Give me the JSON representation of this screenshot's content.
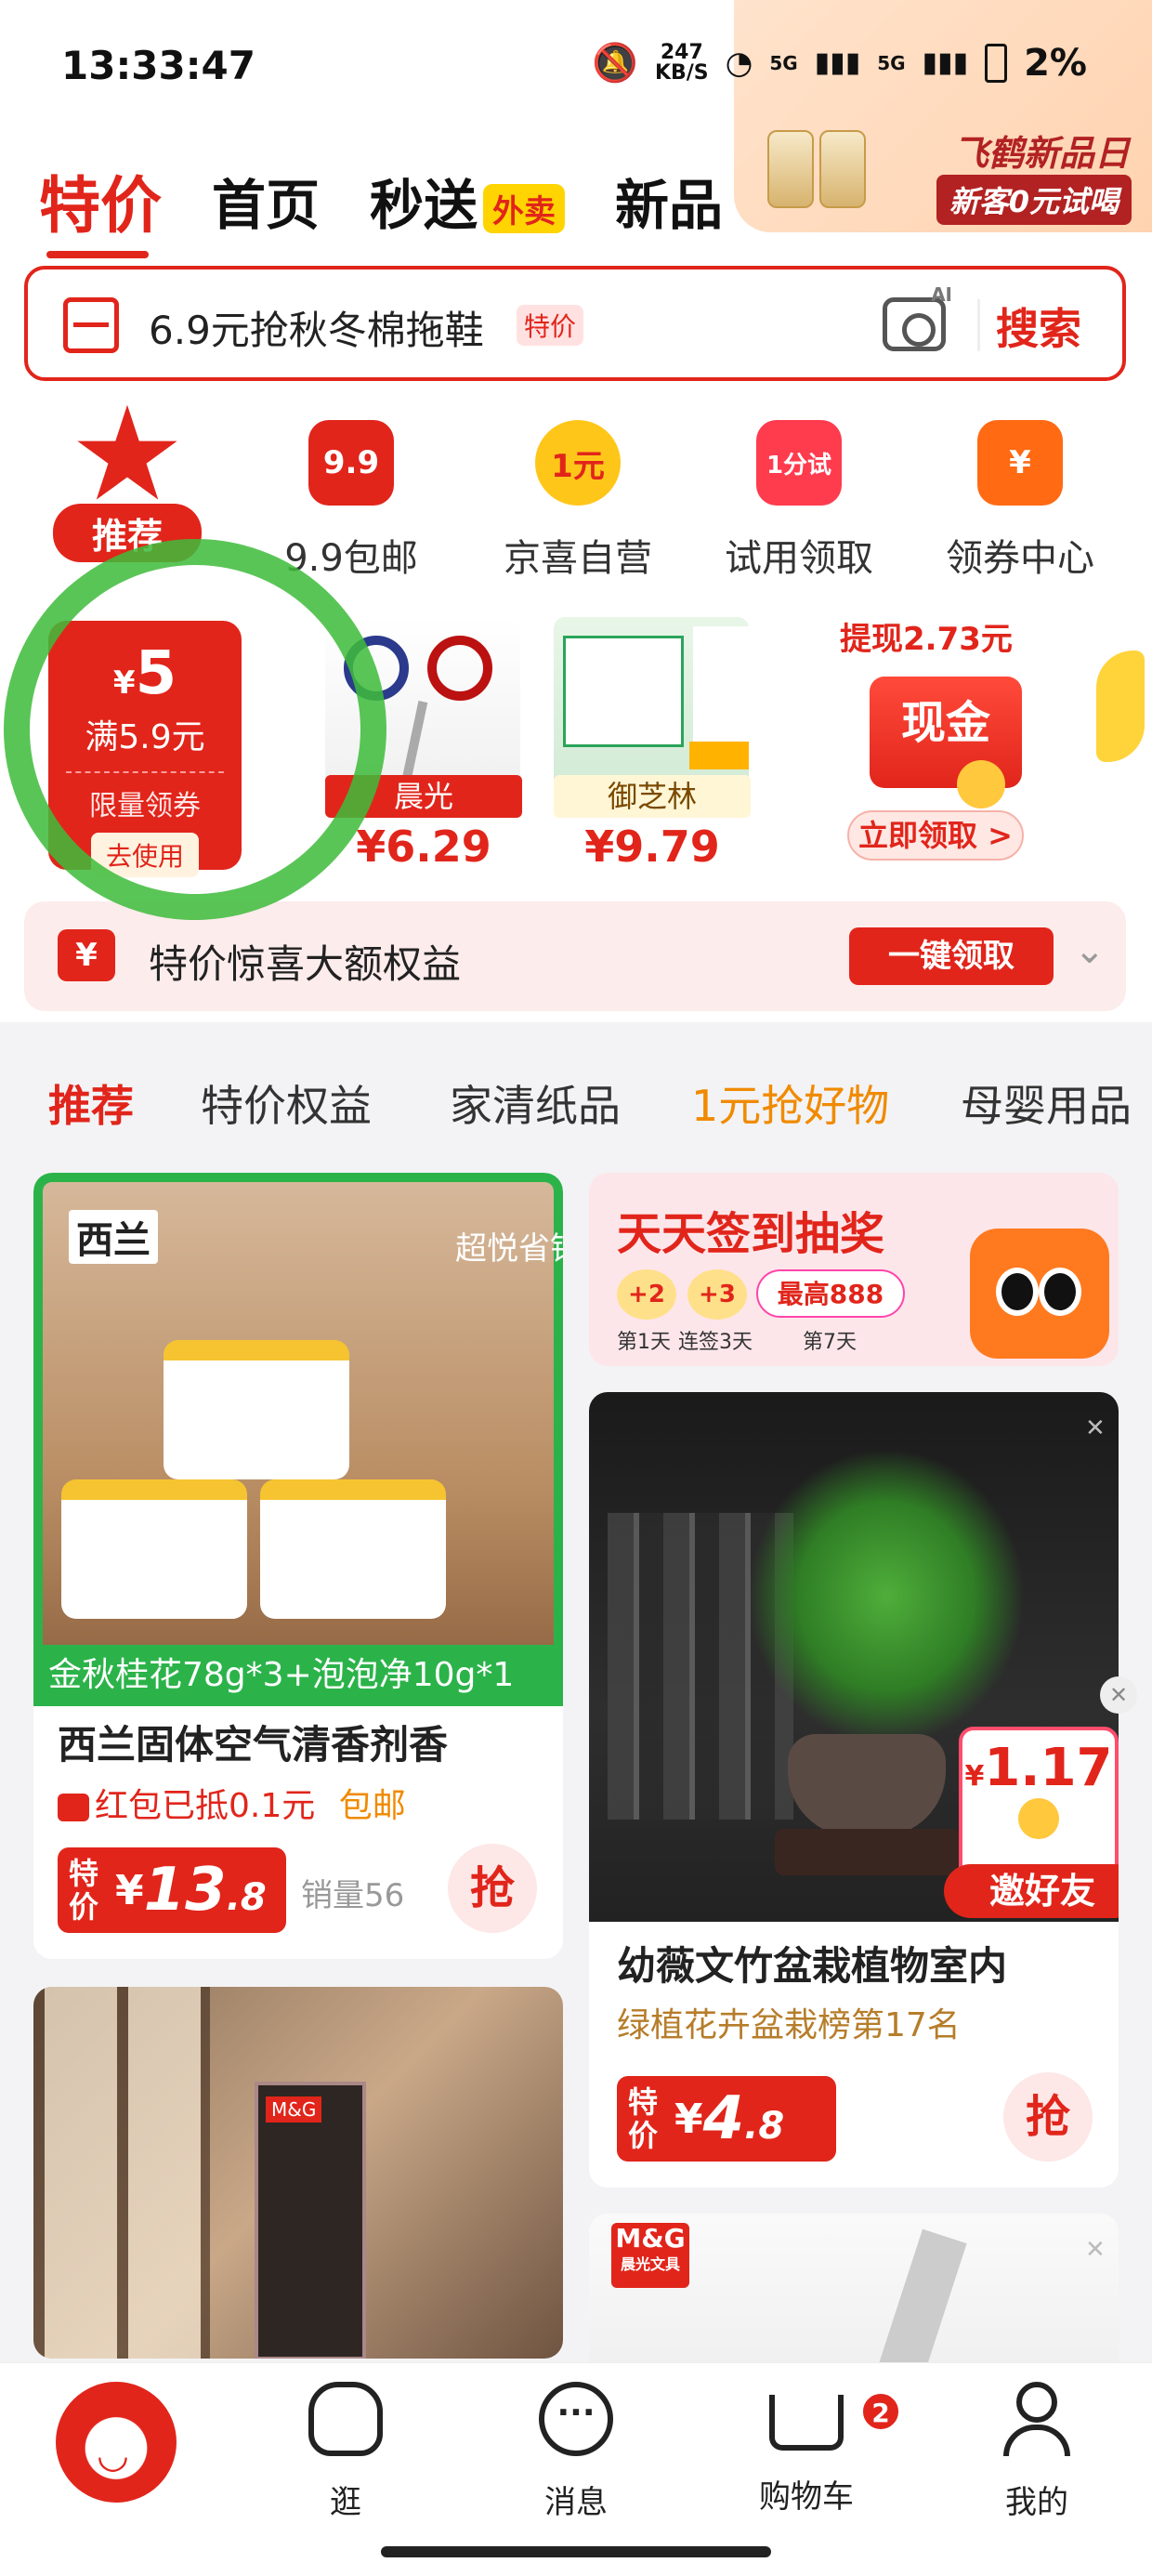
{
  "status": {
    "time": "13:33:47",
    "speed_value": "247",
    "speed_unit": "KB/S",
    "signal1": "5G",
    "signal2": "5G",
    "battery": "2%"
  },
  "promo": {
    "title": "飞鹤新品日",
    "subtitle": "新客0元试喝"
  },
  "top_tabs": [
    {
      "label": "特价"
    },
    {
      "label": "首页"
    },
    {
      "label": "秒送"
    },
    {
      "label": "新品"
    }
  ],
  "takeout_badge": "外卖",
  "search": {
    "query": "6.9元抢秋冬棉拖鞋",
    "badge": "特价",
    "button": "搜索"
  },
  "categories": [
    {
      "label": "推荐",
      "icon": "star-check-icon"
    },
    {
      "label": "9.9包邮",
      "icon_text": "9.9"
    },
    {
      "label": "京喜自营",
      "icon_text": "1元"
    },
    {
      "label": "试用领取",
      "icon_text": "1分试"
    },
    {
      "label": "领券中心",
      "icon_text": "¥"
    }
  ],
  "coupon": {
    "amount": "5",
    "condition": "满5.9元",
    "limit": "限量领券",
    "use": "去使用"
  },
  "deals": [
    {
      "brand": "晨光",
      "price": "¥6.29"
    },
    {
      "brand": "御芝林",
      "price": "¥9.79"
    }
  ],
  "cash": {
    "title": "提现2.73元",
    "box": "现金",
    "button": "立即领取 >"
  },
  "benefit": {
    "icon": "¥",
    "text": "特价惊喜大额权益",
    "button": "一键领取"
  },
  "feed_tabs": [
    {
      "label": "推荐"
    },
    {
      "label": "特价权益"
    },
    {
      "label": "家清纸品"
    },
    {
      "label": "1元抢好物"
    },
    {
      "label": "母婴用品"
    }
  ],
  "products": {
    "p1": {
      "brand": "西兰",
      "watermark": "超悦省钱购",
      "strip": "金秋桂花78g*3+泡泡净10g*1",
      "title": "西兰固体空气清香剂香",
      "coupon": "红包已抵0.1元",
      "shipping": "包邮",
      "price_label": "特价",
      "price_int": "13",
      "price_dec": ".8",
      "sales": "销量56",
      "grab": "抢"
    },
    "p3": {
      "title": "幼薇文竹盆栽植物室内",
      "rank": "绿植花卉盆栽榜第17名",
      "price_label": "特价",
      "price_int": "4",
      "price_dec": ".8",
      "grab": "抢",
      "invite_amount": "1.17",
      "invite_label": "邀好友"
    },
    "p2": {
      "brand_tag": "M&G"
    },
    "p4": {
      "brand": "M&G",
      "brand_sub": "晨光文具"
    }
  },
  "signin": {
    "title": "天天签到抽奖",
    "b1": "+2",
    "b2": "+3",
    "max": "最高888",
    "d1": "第1天",
    "d2": "连签3天",
    "d3": "第7天"
  },
  "bottom_nav": [
    {
      "label": "逛"
    },
    {
      "label": "消息"
    },
    {
      "label": "购物车"
    },
    {
      "label": "我的"
    }
  ],
  "cart_badge": "2",
  "colors": {
    "accent": "#e1251b",
    "annotation_green": "#3fbb3b"
  }
}
